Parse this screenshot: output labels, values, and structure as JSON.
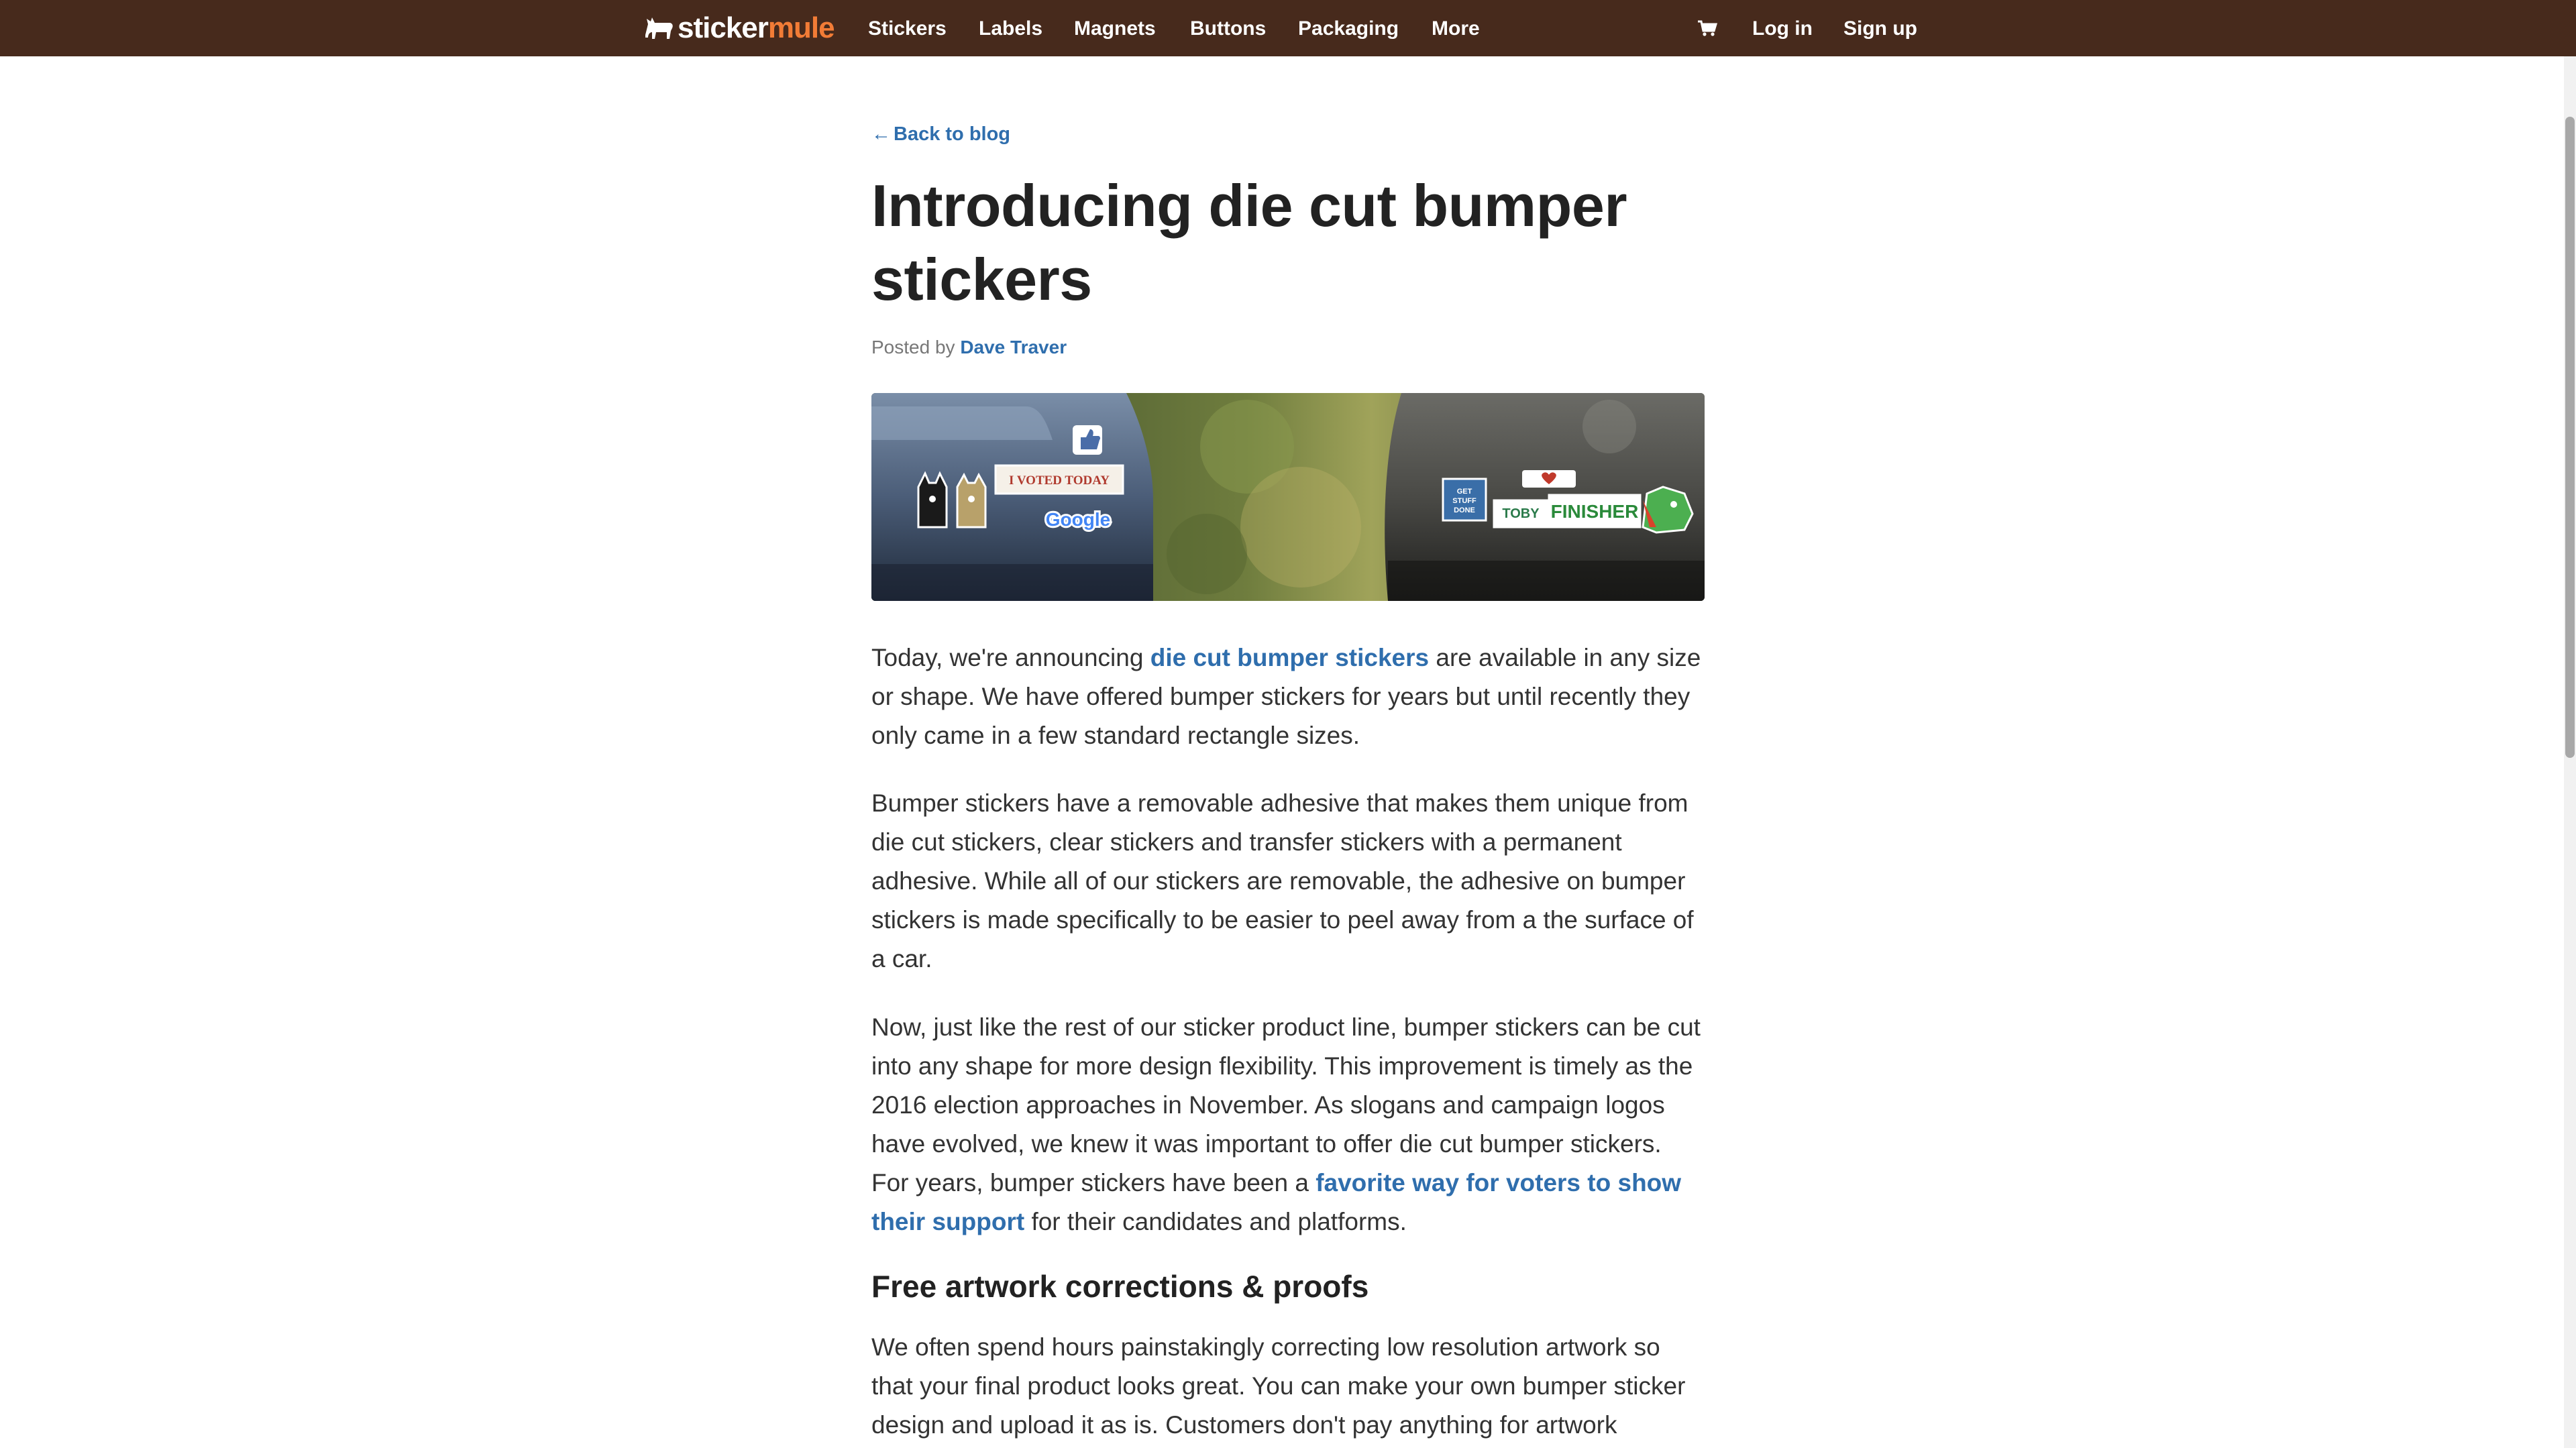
{
  "header": {
    "logo": {
      "part1": "sticker",
      "part2": "mule"
    },
    "nav": {
      "stickers": "Stickers",
      "labels": "Labels",
      "magnets": "Magnets",
      "buttons": "Buttons",
      "packaging": "Packaging",
      "more": "More"
    },
    "cart_icon": "cart-icon",
    "login": "Log in",
    "signup": "Sign up"
  },
  "article": {
    "back_link": "Back to blog",
    "back_arrow": "←",
    "title": "Introducing die cut bumper stickers",
    "byline": {
      "prefix": "Posted by",
      "author": "Dave Traver"
    },
    "hero": {
      "sticker_voted": "I VOTED TODAY",
      "sticker_google": "Google",
      "sticker_get_stuff_done": "GET STUFF DONE",
      "sticker_finisher": "FINISHER",
      "sticker_toby": "TOBY"
    },
    "p1": {
      "before": "Today, we're announcing ",
      "link": "die cut bumper stickers",
      "after": " are available in any size or shape. We have offered bumper stickers for years but until recently they only came in a few standard rectangle sizes."
    },
    "p2": "Bumper stickers have a removable adhesive that makes them unique from die cut stickers, clear stickers and transfer stickers with a permanent adhesive. While all of our stickers are removable, the adhesive on bumper stickers is made specifically to be easier to peel away from a the surface of a car.",
    "p3": {
      "before": "Now, just like the rest of our sticker product line, bumper stickers can be cut into any shape for more design flexibility. This improvement is timely as the 2016 election approaches in November. As slogans and campaign logos have evolved, we knew it was important to offer die cut bumper stickers. For years, bumper stickers have been a ",
      "link": "favorite way for voters to show their support",
      "after": " for their candidates and platforms."
    },
    "h2": "Free artwork corrections & proofs",
    "p4": "We often spend hours painstakingly correcting low resolution artwork so that your final product looks great. You can make your own bumper sticker design and upload it as is. Customers don't pay anything for artwork"
  },
  "colors": {
    "header_bg": "#472a1c",
    "logo_accent": "#f27c36",
    "link": "#2f6ead",
    "text": "#333333"
  }
}
